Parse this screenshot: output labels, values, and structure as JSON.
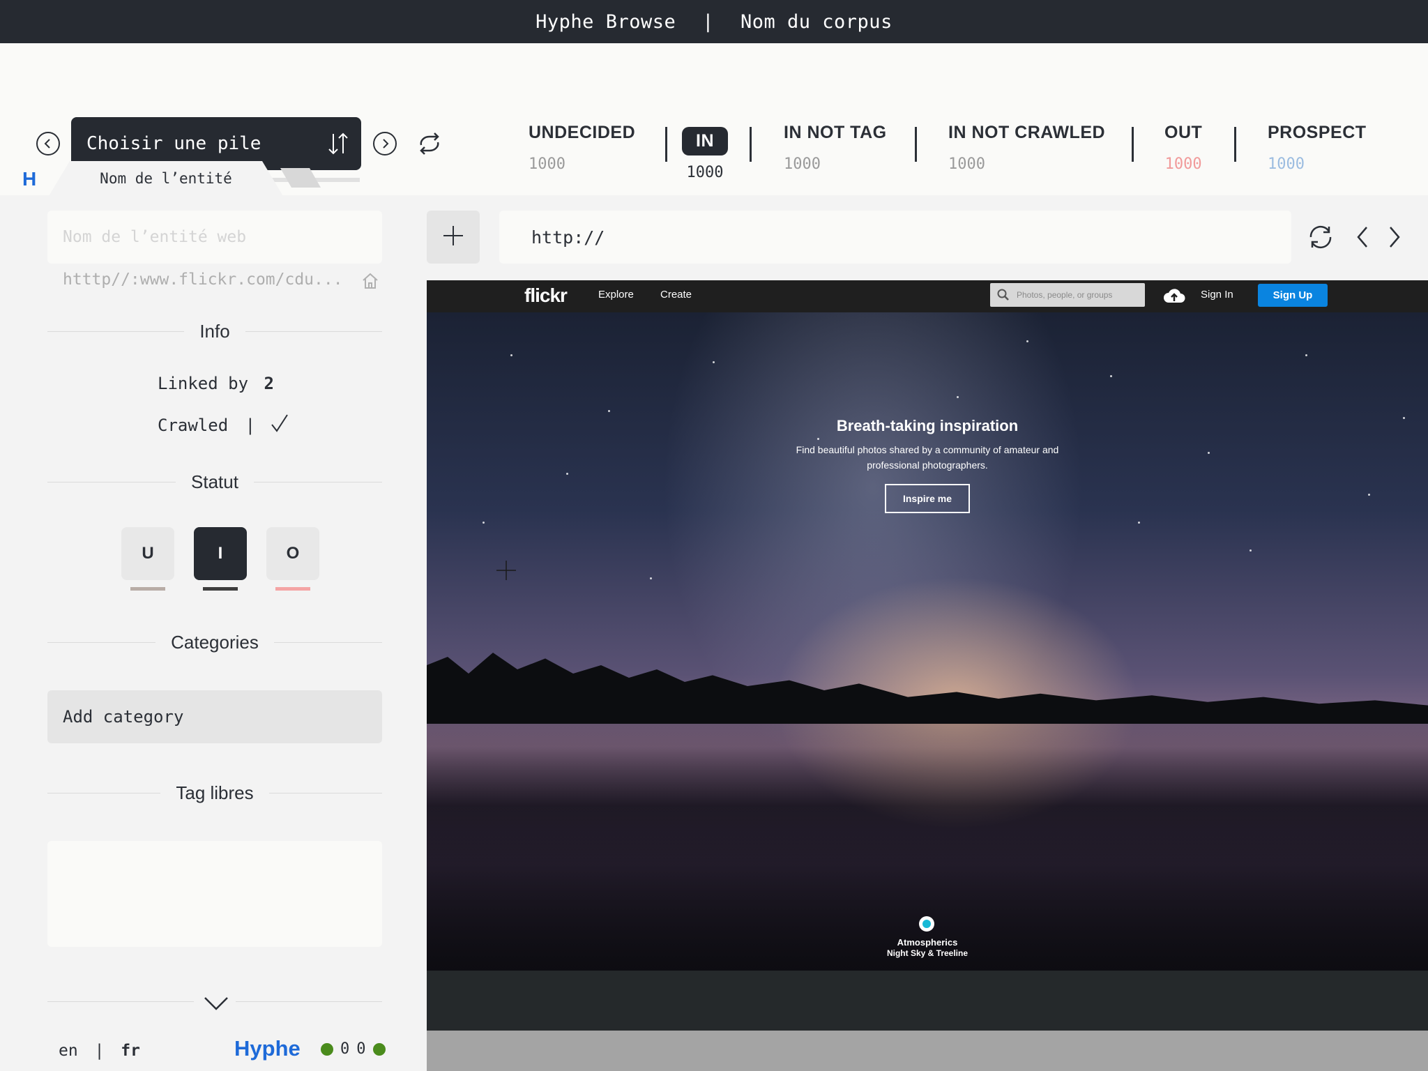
{
  "topbar": {
    "app": "Hyphe Browse",
    "separator": "|",
    "corpus": "Nom du corpus"
  },
  "pile": {
    "label": "Choisir une pile",
    "progress": 0.04
  },
  "statuses": [
    {
      "label": "UNDECIDED",
      "count": "1000",
      "color": "#b0aaa4",
      "active": false
    },
    {
      "label": "IN",
      "count": "1000",
      "color": "#2b2f36",
      "active": true
    },
    {
      "label": "IN NOT TAG",
      "count": "1000",
      "color": "#b0aaa4",
      "active": false
    },
    {
      "label": "IN NOT CRAWLED",
      "count": "1000",
      "color": "#b0aaa4",
      "active": false
    },
    {
      "label": "OUT",
      "count": "1000",
      "color": "#f19a9a",
      "active": false
    },
    {
      "label": "PROSPECT",
      "count": "1000",
      "color": "#9bbce0",
      "active": false
    }
  ],
  "logo_letter": "H",
  "entity_tab": "Nom de l’entité",
  "left": {
    "entity_placeholder": "Nom de l’entité web",
    "entity_url": "htttp//:www.flickr.com/cdu...",
    "info_title": "Info",
    "linked_by_label": "Linked by",
    "linked_by_value": "2",
    "crawled_label": "Crawled",
    "crawled_sep": "|",
    "statut_title": "Statut",
    "status_buttons": [
      {
        "label": "U",
        "underline": "#b8aca6",
        "active": false
      },
      {
        "label": "I",
        "underline": "#3d3d3d",
        "active": true
      },
      {
        "label": "O",
        "underline": "#f4a4a4",
        "active": false
      }
    ],
    "categories_title": "Categories",
    "add_category": "Add category",
    "tags_title": "Tag libres"
  },
  "footer": {
    "lang_en": "en",
    "lang_sep": "|",
    "lang_fr": "fr",
    "brand": "Hyphe",
    "counter_1": "0",
    "counter_2": "0"
  },
  "browser": {
    "url": "http://"
  },
  "flickr": {
    "logo": "flickr",
    "explore": "Explore",
    "create": "Create",
    "search_placeholder": "Photos, people, or groups",
    "sign_in": "Sign In",
    "sign_up": "Sign Up",
    "hero_title": "Breath-taking inspiration",
    "hero_sub": "Find beautiful photos shared by a community of amateur and professional photographers.",
    "inspire": "Inspire me",
    "credit_title": "Atmospherics",
    "credit_sub": "Night Sky & Treeline"
  },
  "colors": {
    "accent_blue": "#1e6ad8",
    "dark": "#262a31",
    "status_ok": "#4a8b1c",
    "flickr_blue": "#0a84e0"
  }
}
